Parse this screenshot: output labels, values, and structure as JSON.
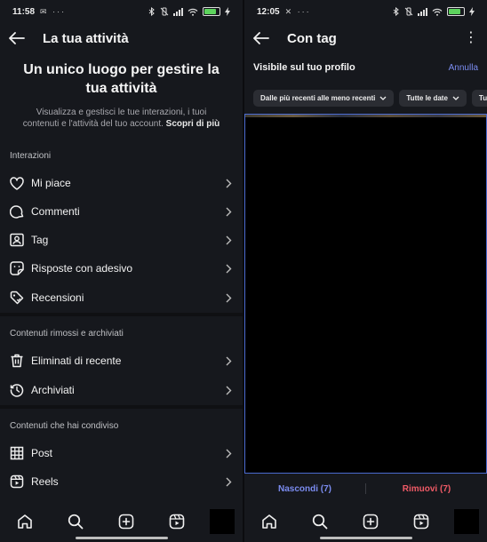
{
  "left": {
    "status": {
      "time": "11:58",
      "left_icons": "✉ ···",
      "battery_level": 0.85
    },
    "header": {
      "title": "La tua attività"
    },
    "hero": {
      "title": "Un unico luogo per gestire la tua attività",
      "description": "Visualizza e gestisci le tue interazioni, i tuoi contenuti e l'attività del tuo account.",
      "link": "Scopri di più"
    },
    "sections": [
      {
        "title": "Interazioni",
        "items": [
          {
            "label": "Mi piace",
            "icon": "heart-icon"
          },
          {
            "label": "Commenti",
            "icon": "comment-icon"
          },
          {
            "label": "Tag",
            "icon": "tag-person-icon"
          },
          {
            "label": "Risposte con adesivo",
            "icon": "sticker-icon"
          },
          {
            "label": "Recensioni",
            "icon": "review-tag-icon"
          }
        ]
      },
      {
        "title": "Contenuti rimossi e archiviati",
        "items": [
          {
            "label": "Eliminati di recente",
            "icon": "trash-icon"
          },
          {
            "label": "Archiviati",
            "icon": "archive-history-icon"
          }
        ]
      },
      {
        "title": "Contenuti che hai condiviso",
        "items": [
          {
            "label": "Post",
            "icon": "grid-icon"
          },
          {
            "label": "Reels",
            "icon": "reels-icon"
          }
        ]
      }
    ]
  },
  "right": {
    "status": {
      "time": "12:05",
      "left_icons": "✕ ···",
      "battery_level": 0.85
    },
    "header": {
      "title": "Con tag"
    },
    "visible_title": "Visibile sul tuo profilo",
    "cancel": "Annulla",
    "chips": [
      "Dalle più recenti alle meno recenti",
      "Tutte le date",
      "Tutti"
    ],
    "actions": {
      "hide": "Nascondi (7)",
      "remove": "Rimuovi (7)"
    }
  },
  "nav": [
    "home-icon",
    "search-icon",
    "create-icon",
    "reels-nav-icon",
    "profile-avatar"
  ],
  "colors": {
    "accent": "#7b8cf0",
    "danger": "#ef5a66",
    "background": "#16181d"
  }
}
